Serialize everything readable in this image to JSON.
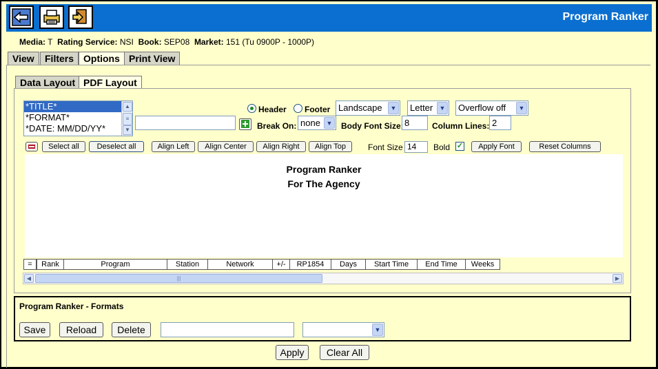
{
  "app": {
    "title": "Program Ranker"
  },
  "toolbar": {
    "back_icon": "back-arrow-icon",
    "print_icon": "printer-icon",
    "export_icon": "export-icon"
  },
  "meta": {
    "media_label": "Media:",
    "media_value": "T",
    "rating_label": "Rating Service:",
    "rating_value": "NSI",
    "book_label": "Book:",
    "book_value": "SEP08",
    "market_label": "Market:",
    "market_value": "151 (Tu 0900P - 1000P)"
  },
  "main_tabs": [
    "View",
    "Filters",
    "Options",
    "Print View"
  ],
  "sub_tabs": [
    "Data Layout",
    "PDF Layout"
  ],
  "fields_list": [
    "*TITLE*",
    "*FORMAT*",
    "*DATE: MM/DD/YY*"
  ],
  "header_footer": {
    "header_label": "Header",
    "footer_label": "Footer",
    "selected": "Header"
  },
  "selects": {
    "orientation": "Landscape",
    "paper": "Letter",
    "overflow": "Overflow off",
    "break_on": "none"
  },
  "labels": {
    "break_on": "Break On:",
    "body_font_size": "Body Font Size:",
    "column_lines": "Column Lines:",
    "font_size": "Font Size",
    "bold": "Bold"
  },
  "values": {
    "body_font_size": "8",
    "column_lines": "2",
    "font_size": "14",
    "text_input": ""
  },
  "column_buttons": {
    "select_all": "Select all",
    "deselect_all": "Deselect all",
    "align_left": "Align Left",
    "align_center": "Align Center",
    "align_right": "Align Right",
    "align_top": "Align Top",
    "apply_font": "Apply Font",
    "reset_columns": "Reset Columns"
  },
  "preview": {
    "title_line1": "Program Ranker",
    "title_line2": "For The Agency"
  },
  "columns": [
    "=",
    "Rank",
    "Program",
    "Station",
    "Network",
    "+/-",
    "RP1854",
    "Days",
    "Start Time",
    "End Time",
    "Weeks"
  ],
  "formats": {
    "title": "Program Ranker - Formats",
    "save": "Save",
    "reload": "Reload",
    "delete": "Delete",
    "name_value": "",
    "select_value": ""
  },
  "footer_buttons": {
    "apply": "Apply",
    "clear_all": "Clear All"
  },
  "colors": {
    "topbar": "#0a6fd0",
    "background": "#ffffcc",
    "selection": "#316ac5"
  }
}
